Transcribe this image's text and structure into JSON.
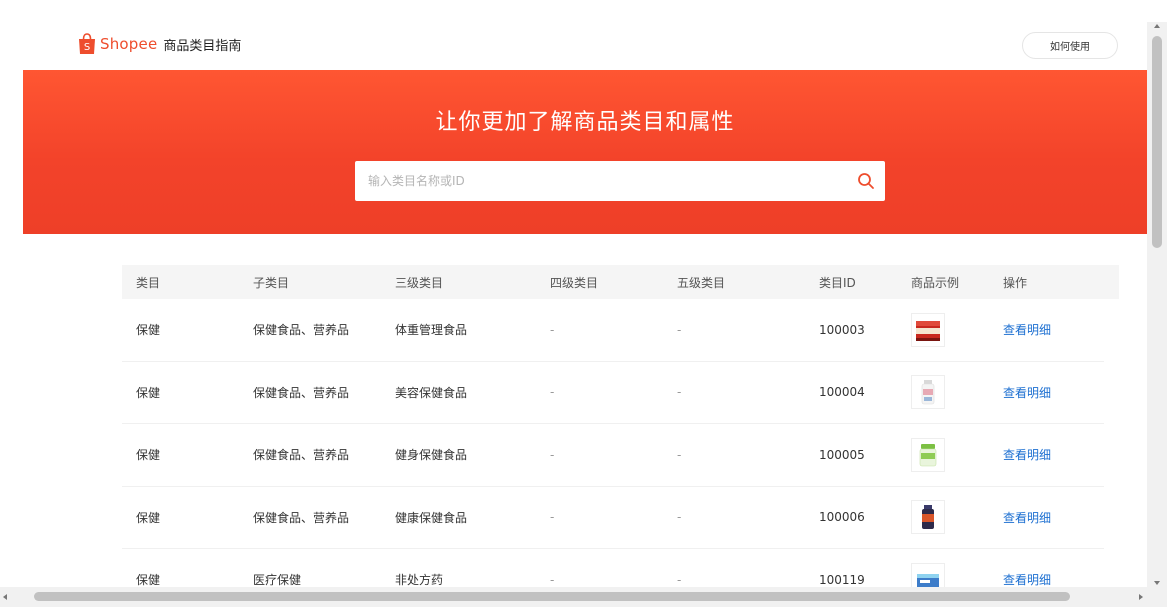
{
  "header": {
    "brand": "Shopee",
    "subtitle": "商品类目指南",
    "help_button": "如何使用",
    "bag_letter": "S"
  },
  "banner": {
    "title": "让你更加了解商品类目和属性",
    "search_placeholder": "输入类目名称或ID"
  },
  "table": {
    "columns": [
      "类目",
      "子类目",
      "三级类目",
      "四级类目",
      "五级类目",
      "类目ID",
      "商品示例",
      "操作"
    ],
    "rows": [
      {
        "cat": "保健",
        "sub": "保健食品、营养品",
        "l3": "体重管理食品",
        "l4": "-",
        "l5": "-",
        "id": "100003",
        "thumb": "red-supplement-tub",
        "action": "查看明细"
      },
      {
        "cat": "保健",
        "sub": "保健食品、营养品",
        "l3": "美容保健食品",
        "l4": "-",
        "l5": "-",
        "id": "100004",
        "thumb": "white-supplement-bottle",
        "action": "查看明细"
      },
      {
        "cat": "保健",
        "sub": "保健食品、营养品",
        "l3": "健身保健食品",
        "l4": "-",
        "l5": "-",
        "id": "100005",
        "thumb": "green-protein-jar",
        "action": "查看明细"
      },
      {
        "cat": "保健",
        "sub": "保健食品、营养品",
        "l3": "健康保健食品",
        "l4": "-",
        "l5": "-",
        "id": "100006",
        "thumb": "dark-vitamin-bottle",
        "action": "查看明细"
      },
      {
        "cat": "保健",
        "sub": "医疗保健",
        "l3": "非处方药",
        "l4": "-",
        "l5": "-",
        "id": "100119",
        "thumb": "medicine-box",
        "action": "查看明细"
      }
    ]
  },
  "colors": {
    "brand": "#ee4d2d",
    "banner_top": "#ff5632",
    "banner_bottom": "#ee3f28",
    "link": "#1c6fd1"
  }
}
